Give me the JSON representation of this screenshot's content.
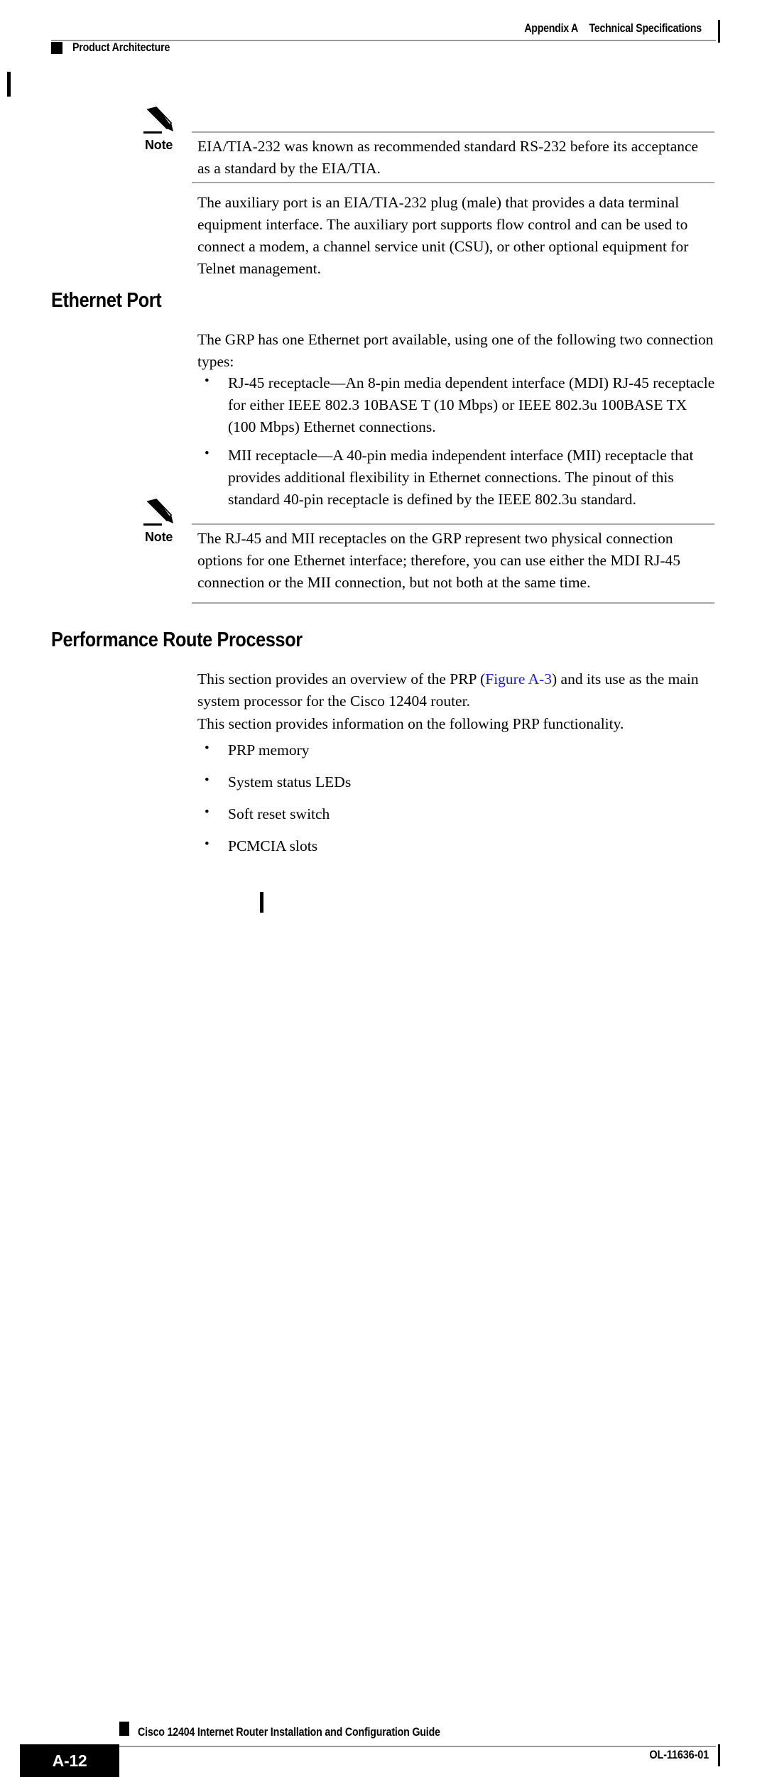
{
  "header": {
    "appendix_label": "Appendix A",
    "appendix_title": "Technical Specifications",
    "running_section": "Product Architecture"
  },
  "notes": [
    {
      "label": "Note",
      "text": "EIA/TIA-232 was known as recommended standard RS-232 before its acceptance as a standard by the EIA/TIA."
    },
    {
      "label": "Note",
      "text": "The RJ-45 and MII receptacles on the GRP represent two physical connection options for one Ethernet interface; therefore, you can use either the MDI RJ-45 connection or the MII connection, but not both at the same time."
    }
  ],
  "paragraphs": {
    "aux_port": "The auxiliary port is an EIA/TIA-232 plug (male) that provides a data terminal equipment interface. The auxiliary port supports flow control and can be used to connect a modem, a channel service unit (CSU), or other optional equipment for Telnet management.",
    "ethernet_intro": "The GRP has one Ethernet port available, using one of the following two connection types:",
    "prp_overview_before_link": "This section provides an overview of the PRP (",
    "prp_overview_link": "Figure A-3",
    "prp_overview_after_link": ") and its use as the main system processor for the Cisco 12404 router.",
    "prp_functionality_intro": "This section provides information on the following PRP functionality."
  },
  "sections": [
    {
      "id": "ethernet-port",
      "heading": "Ethernet Port"
    },
    {
      "id": "performance-route-processor",
      "heading": "Performance Route Processor"
    }
  ],
  "ethernet_bullets": [
    "RJ-45 receptacle—An 8-pin media dependent interface (MDI) RJ-45 receptacle for either IEEE 802.3 10BASE T (10 Mbps) or IEEE 802.3u 100BASE TX (100 Mbps) Ethernet connections.",
    "MII receptacle—A 40-pin media independent interface (MII) receptacle that provides additional flexibility in Ethernet connections. The pinout of this standard 40-pin receptacle is defined by the IEEE 802.3u standard."
  ],
  "prp_bullets": [
    "PRP memory",
    "System status LEDs",
    "Soft reset switch",
    "PCMCIA slots"
  ],
  "footer": {
    "page_number": "A-12",
    "guide_title": "Cisco 12404 Internet Router Installation and Configuration Guide",
    "doc_number": "OL-11636-01"
  },
  "colors": {
    "link": "#1a1ae0",
    "rule": "#9a9a9a",
    "note_rule": "#a8a8a8",
    "ink": "#000000"
  }
}
